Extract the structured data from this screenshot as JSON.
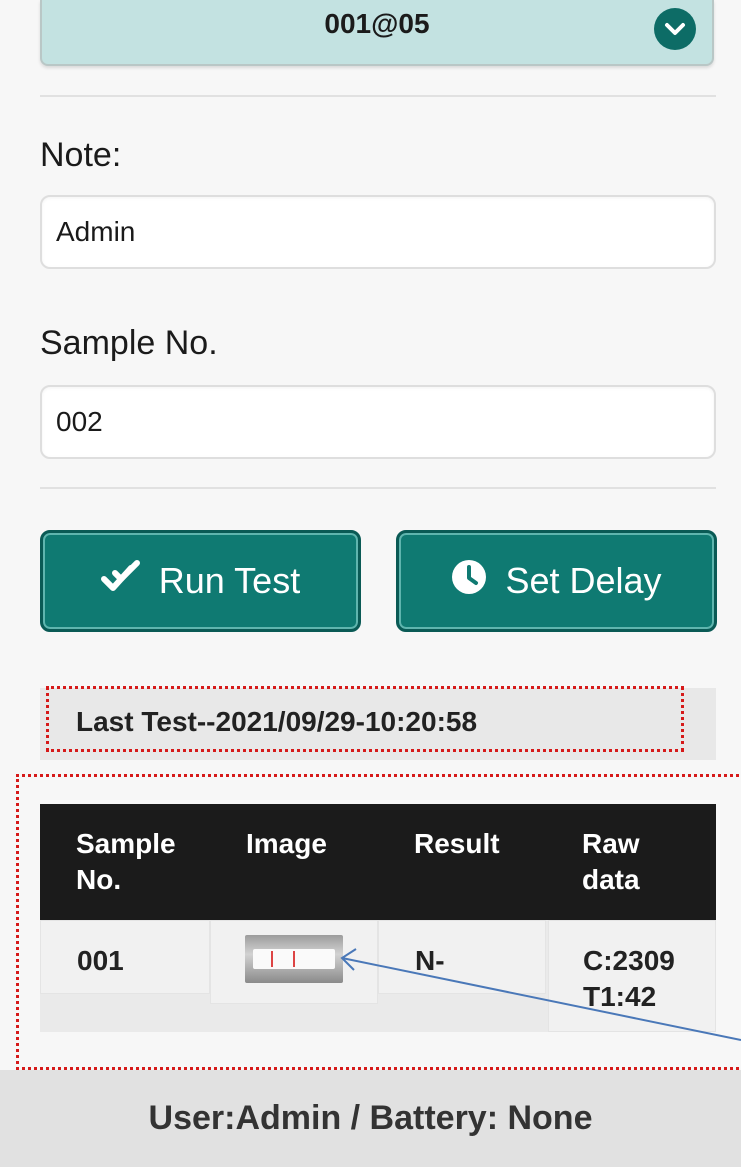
{
  "selector": {
    "value": "001@05",
    "icon": "chevron-down-icon"
  },
  "note": {
    "label": "Note:",
    "value": "Admin"
  },
  "sample": {
    "label": "Sample No.",
    "value": "002"
  },
  "buttons": {
    "run_test": {
      "label": "Run Test",
      "icon": "check-double-icon"
    },
    "set_delay": {
      "label": "Set Delay",
      "icon": "clock-icon"
    }
  },
  "last_test": {
    "text": "Last Test--2021/09/29-10:20:58"
  },
  "table": {
    "headers": [
      "Sample\nNo.",
      "Image",
      "Result",
      "Raw\ndata"
    ],
    "rows": [
      {
        "sample_no": "001",
        "image": "test-strip-thumbnail",
        "result": "N-",
        "raw_data": "C:2309\nT1:42"
      }
    ]
  },
  "footer": {
    "text": "User:Admin / Battery: None"
  },
  "colors": {
    "accent": "#0f7a72",
    "select_bg": "#c3e2e1",
    "header_bg": "#1b1b1b",
    "annotation": "#d61a1a",
    "arrow": "#4a78b8"
  }
}
